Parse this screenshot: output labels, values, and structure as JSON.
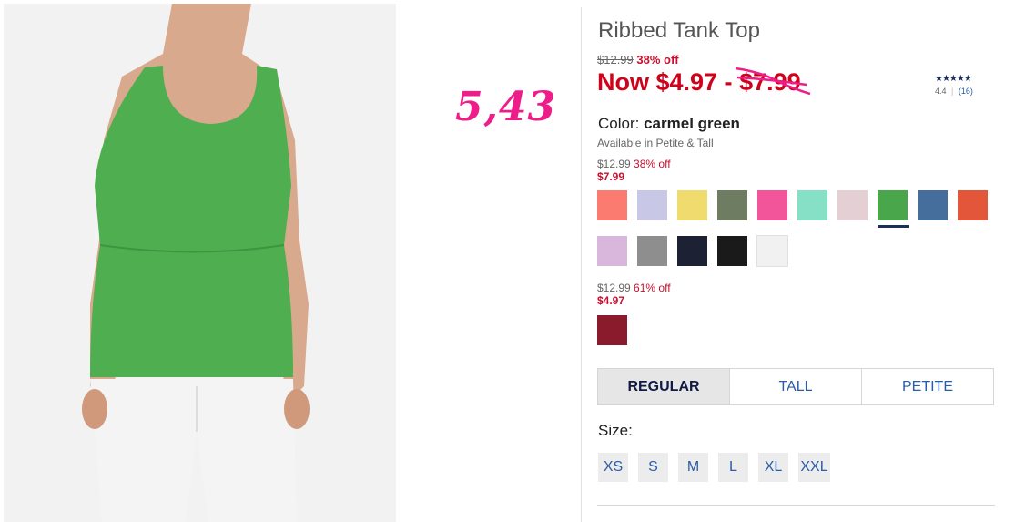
{
  "product": {
    "title": "Ribbed Tank Top",
    "was_price": "$12.99",
    "was_off": "38% off",
    "now_prefix": "Now $4.97 - ",
    "now_strike": "$7.99",
    "rating_stars": "★★★★★",
    "rating_value": "4.4",
    "rating_sep": "|",
    "rating_count": "(16)",
    "color_label": "Color:",
    "color_value": "carmel green",
    "availability": "Available in Petite & Tall"
  },
  "annotation": {
    "handwritten_price": "5,43"
  },
  "price_groups": [
    {
      "orig": "$12.99",
      "off": "38% off",
      "price": "$7.99"
    },
    {
      "orig": "$12.99",
      "off": "61% off",
      "price": "$4.97"
    }
  ],
  "swatches": {
    "group1": [
      "#fb7b70",
      "#c8c8e6",
      "#f0dc6e",
      "#6e7c62",
      "#f2559a",
      "#86e0c6",
      "#e4d0d4",
      "#4aa64a",
      "#466e9c",
      "#e4563a",
      "#d9b6dc",
      "#8e8e8e",
      "#1c2233",
      "#1a1a1a",
      "#f1f1f1"
    ],
    "group1_selected": 7,
    "group2": [
      "#8a1b2c"
    ]
  },
  "fit_tabs": [
    "REGULAR",
    "TALL",
    "PETITE"
  ],
  "fit_active": "REGULAR",
  "size_label": "Size:",
  "sizes": [
    "XS",
    "S",
    "M",
    "L",
    "XL",
    "XXL"
  ],
  "photo": {
    "garment_color": "#4fae4f",
    "pants_color": "#f4f4f4",
    "skin_color": "#d9a98d"
  }
}
